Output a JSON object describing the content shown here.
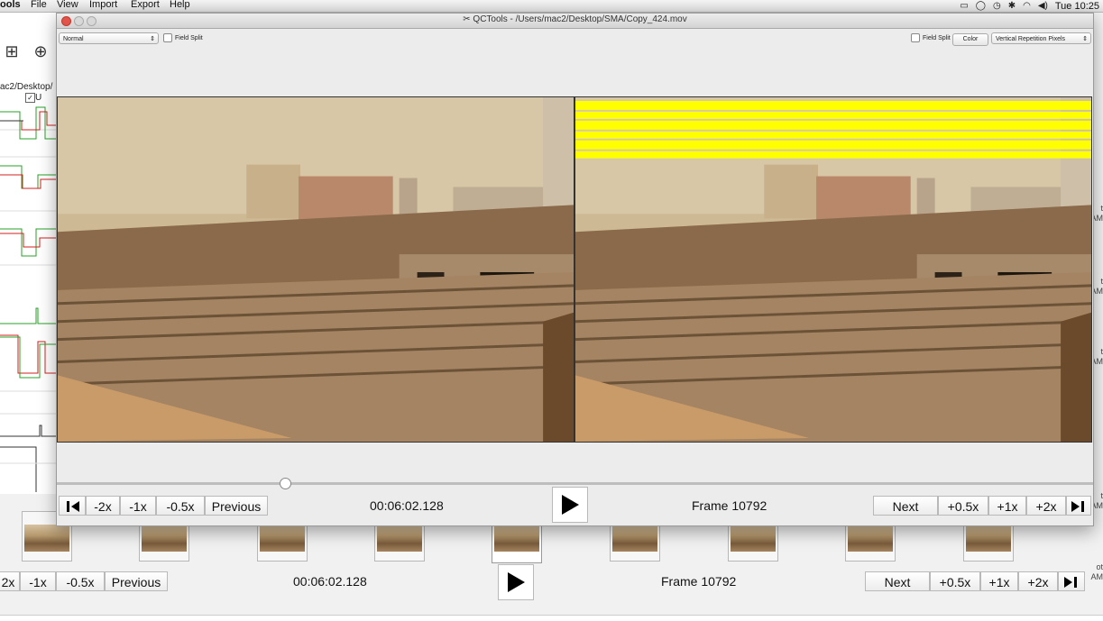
{
  "menubar": {
    "app_name": "ools",
    "items": [
      "File",
      "View",
      "Import",
      "Export",
      "Help"
    ],
    "clock": "Tue 10:25"
  },
  "background_app": {
    "path_fragment": "ac2/Desktop/",
    "checkbox_label": "U",
    "right_edge_labels": [
      "t",
      "AM",
      "t",
      "AM",
      "t",
      "AM",
      "t",
      "AM",
      "ot",
      "AM"
    ],
    "controls": {
      "minus_2x": "2x",
      "minus_1x": "-1x",
      "minus_half": "-0.5x",
      "previous": "Previous",
      "timecode": "00:06:02.128",
      "frame": "Frame 10792",
      "next": "Next",
      "plus_half": "+0.5x",
      "plus_1x": "+1x",
      "plus_2x": "+2x"
    }
  },
  "window": {
    "title": "QCTools - /Users/mac2/Desktop/SMA/Copy_424.mov",
    "left_filter": "Normal",
    "left_field_split": "Field Split",
    "right_field_split": "Field Split",
    "color_button": "Color",
    "right_filter": "Vertical Repetition Pixels",
    "controls": {
      "minus_2x": "-2x",
      "minus_1x": "-1x",
      "minus_half": "-0.5x",
      "previous": "Previous",
      "timecode": "00:06:02.128",
      "frame": "Frame 10792",
      "next": "Next",
      "plus_half": "+0.5x",
      "plus_1x": "+1x",
      "plus_2x": "+2x"
    }
  },
  "colors": {
    "highlight_overlay": "#ffff00",
    "trace_green": "#28a028",
    "trace_red": "#d02020"
  }
}
